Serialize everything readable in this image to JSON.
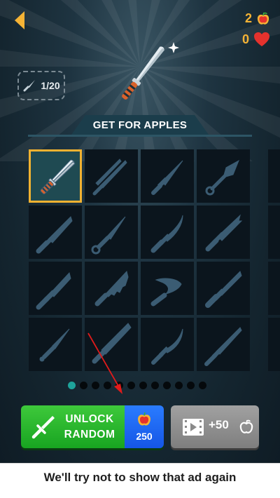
{
  "header": {
    "apples_count": "2",
    "lives_count": "0",
    "knife_progress": "1/20"
  },
  "shop": {
    "section_title": "GET FOR APPLES",
    "tiles": [
      {
        "id": "knife-1",
        "shape": "chef-knife",
        "selected": true,
        "unlocked": true
      },
      {
        "id": "knife-2",
        "shape": "twin-blade",
        "selected": false,
        "unlocked": false
      },
      {
        "id": "knife-3",
        "shape": "dagger",
        "selected": false,
        "unlocked": false
      },
      {
        "id": "knife-4",
        "shape": "kunai",
        "selected": false,
        "unlocked": false
      },
      {
        "id": "knife-5",
        "shape": "combat-knife",
        "selected": false,
        "unlocked": false
      },
      {
        "id": "knife-6",
        "shape": "ring-knife",
        "selected": false,
        "unlocked": false
      },
      {
        "id": "knife-7",
        "shape": "hunting-knife",
        "selected": false,
        "unlocked": false
      },
      {
        "id": "knife-8",
        "shape": "bowie-knife",
        "selected": false,
        "unlocked": false
      },
      {
        "id": "knife-9",
        "shape": "tactical-knife",
        "selected": false,
        "unlocked": false
      },
      {
        "id": "knife-10",
        "shape": "serrated-knife",
        "selected": false,
        "unlocked": false
      },
      {
        "id": "knife-11",
        "shape": "kukri",
        "selected": false,
        "unlocked": false
      },
      {
        "id": "knife-12",
        "shape": "army-knife",
        "selected": false,
        "unlocked": false
      },
      {
        "id": "knife-13",
        "shape": "throwing-knife",
        "selected": false,
        "unlocked": false
      },
      {
        "id": "knife-14",
        "shape": "machete",
        "selected": false,
        "unlocked": false
      },
      {
        "id": "knife-15",
        "shape": "curved-dagger",
        "selected": false,
        "unlocked": false
      },
      {
        "id": "knife-16",
        "shape": "long-knife",
        "selected": false,
        "unlocked": false
      }
    ],
    "pages": 12,
    "active_page": 1
  },
  "actions": {
    "unlock_line1": "UNLOCK",
    "unlock_line2": "RANDOM",
    "unlock_cost": "250",
    "video_reward": "+50"
  },
  "toast": {
    "message": "We'll try not to show that ad again"
  },
  "colors": {
    "accent_orange": "#f5b335",
    "unlock_green": "#3ec93b",
    "unlock_blue": "#2a7cff",
    "selected_border": "#f2b231",
    "pager_active": "#1ea39b",
    "annotation_arrow": "#e01b1b"
  },
  "icons": {
    "back": "back-arrow-icon",
    "apple": "apple-icon",
    "heart": "heart-icon",
    "knife": "knife-icon",
    "sword": "sword-icon",
    "video": "film-icon"
  }
}
